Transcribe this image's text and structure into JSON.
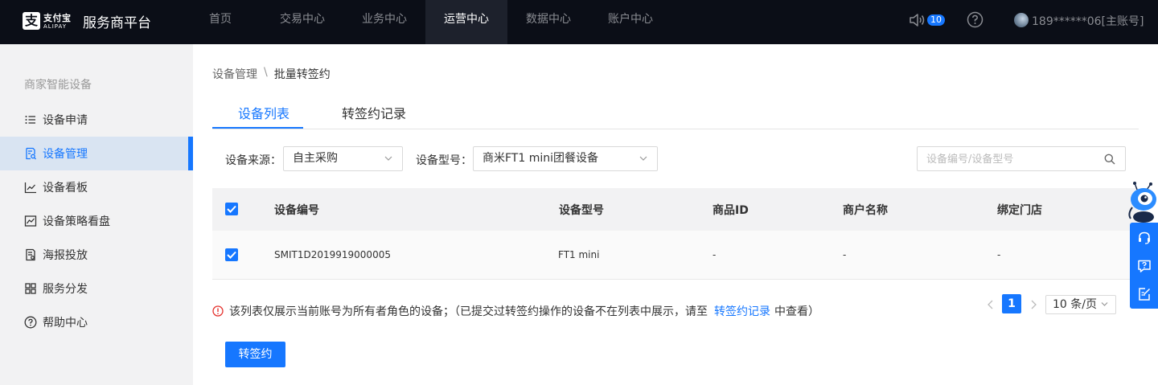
{
  "header": {
    "logo_cn": "支付宝",
    "logo_en": "ALIPAY",
    "platform_name": "服务商平台",
    "nav": [
      {
        "label": "首页",
        "active": false
      },
      {
        "label": "交易中心",
        "active": false
      },
      {
        "label": "业务中心",
        "active": false
      },
      {
        "label": "运营中心",
        "active": true
      },
      {
        "label": "数据中心",
        "active": false
      },
      {
        "label": "账户中心",
        "active": false
      }
    ],
    "notification_count": "10",
    "account": "189******06[主账号]"
  },
  "sidebar": {
    "title": "商家智能设备",
    "items": [
      {
        "label": "设备申请",
        "icon": "list-icon",
        "active": false
      },
      {
        "label": "设备管理",
        "icon": "document-search-icon",
        "active": true
      },
      {
        "label": "设备看板",
        "icon": "line-chart-icon",
        "active": false
      },
      {
        "label": "设备策略看盘",
        "icon": "area-chart-icon",
        "active": false
      },
      {
        "label": "海报投放",
        "icon": "document-icon",
        "active": false
      },
      {
        "label": "服务分发",
        "icon": "grid-icon",
        "active": false
      },
      {
        "label": "帮助中心",
        "icon": "help-circle-icon",
        "active": false
      }
    ]
  },
  "breadcrumb": {
    "parent": "设备管理",
    "separator": "\\",
    "current": "批量转签约"
  },
  "tabs": [
    {
      "label": "设备列表",
      "active": true
    },
    {
      "label": "转签约记录",
      "active": false
    }
  ],
  "filters": {
    "source_label": "设备来源：",
    "source_value": "自主采购",
    "model_label": "设备型号：",
    "model_value": "商米FT1 mini团餐设备",
    "search_placeholder": "设备编号/设备型号"
  },
  "table": {
    "columns": [
      "设备编号",
      "设备型号",
      "商品ID",
      "商户名称",
      "绑定门店"
    ],
    "header_checked": true,
    "rows": [
      {
        "checked": true,
        "cells": [
          "SMIT1D2019919000005",
          "FT1 mini",
          "-",
          "-",
          "-"
        ]
      }
    ]
  },
  "notice": {
    "text_before": "该列表仅展示当前账号为所有者角色的设备；（已提交过转签约操作的设备不在列表中展示，请至",
    "link": "转签约记录",
    "text_after": "中查看）"
  },
  "pagination": {
    "current_page": "1",
    "page_size": "10 条/页"
  },
  "actions": {
    "primary_button": "转签约"
  },
  "colors": {
    "primary": "#1677ff",
    "topbar": "#0b0e17",
    "sidebar_bg": "#f2f2f3"
  }
}
